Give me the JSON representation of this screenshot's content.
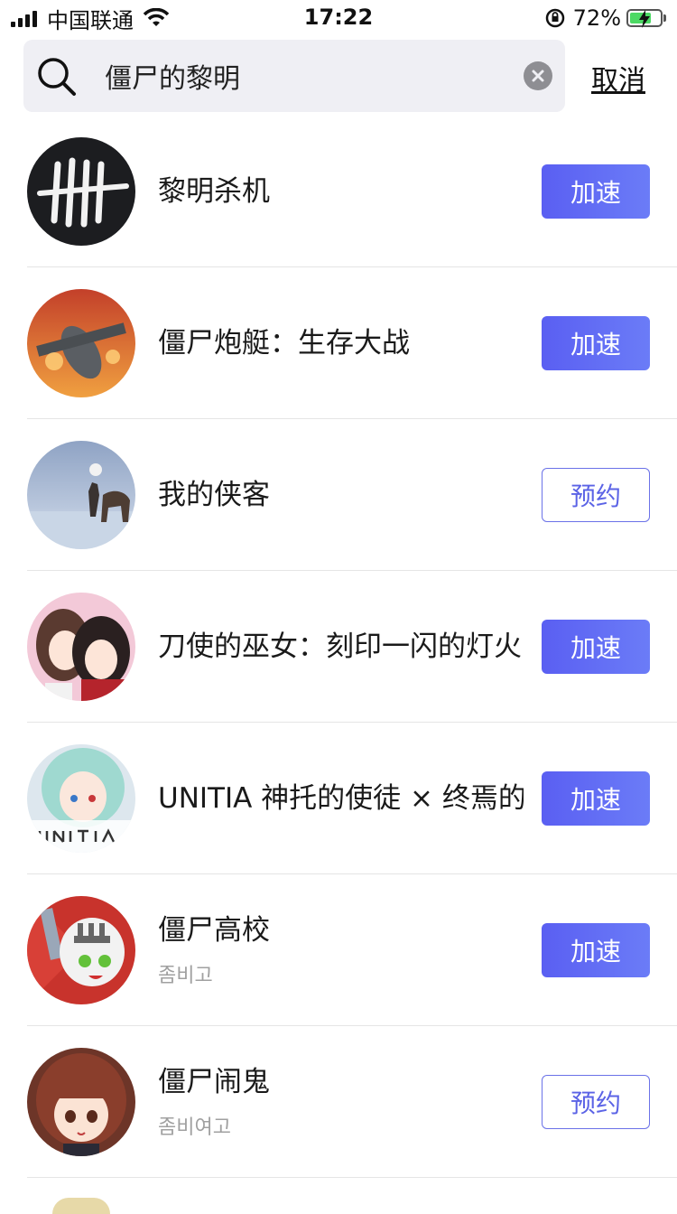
{
  "status_bar": {
    "carrier": "中国联通",
    "time": "17:22",
    "battery_percent": "72%",
    "battery_level": 0.72
  },
  "search": {
    "query": "僵尸的黎明",
    "cancel_label": "取消"
  },
  "results": [
    {
      "title": "黎明杀机",
      "subtitle": "",
      "action": "加速",
      "action_type": "accelerate",
      "icon": "dead-by-daylight-icon"
    },
    {
      "title": "僵尸炮艇：生存大战",
      "subtitle": "",
      "action": "加速",
      "action_type": "accelerate",
      "icon": "gunship-plane-icon"
    },
    {
      "title": "我的侠客",
      "subtitle": "",
      "action": "预约",
      "action_type": "reserve",
      "icon": "wanderer-horse-icon"
    },
    {
      "title": "刀使的巫女：刻印一闪的灯火",
      "subtitle": "",
      "action": "加速",
      "action_type": "accelerate",
      "icon": "anime-girls-icon"
    },
    {
      "title": "UNITIA 神托的使徒 × 终焉的女神",
      "subtitle": "",
      "action": "加速",
      "action_type": "accelerate",
      "icon": "unitia-girl-icon"
    },
    {
      "title": "僵尸高校",
      "subtitle": "좀비고",
      "action": "加速",
      "action_type": "accelerate",
      "icon": "knight-helmet-icon"
    },
    {
      "title": "僵尸闹鬼",
      "subtitle": "좀비여고",
      "action": "预约",
      "action_type": "reserve",
      "icon": "brown-hair-girl-icon"
    }
  ],
  "colors": {
    "accent": "#5a5ff2",
    "search_bg": "#efeff4",
    "divider": "#e5e5e5",
    "subtitle": "#a0a0a0"
  }
}
